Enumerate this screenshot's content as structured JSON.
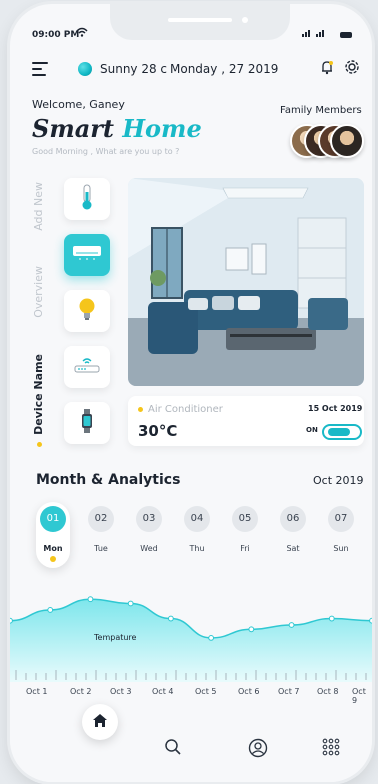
{
  "status_bar": {
    "time": "09:00 PM"
  },
  "header": {
    "weather": "Sunny 28 c",
    "date": "Monday , 27 2019"
  },
  "welcome": {
    "greeting": "Welcome, Ganey",
    "title_a": "Smart",
    "title_b": "Home",
    "subtitle": "Good Morning , What are you up to ?",
    "family_label": "Family Members"
  },
  "side_tabs": [
    {
      "label": "Add New"
    },
    {
      "label": "Overview"
    },
    {
      "label": "Device Name"
    }
  ],
  "devices": [
    {
      "icon": "thermometer-icon"
    },
    {
      "icon": "air-conditioner-icon"
    },
    {
      "icon": "light-bulb-icon"
    },
    {
      "icon": "router-icon"
    },
    {
      "icon": "smartwatch-icon"
    }
  ],
  "ac_card": {
    "name": "Air Conditioner",
    "temp": "30°C",
    "date": "15 Oct 2019",
    "state": "ON"
  },
  "analytics": {
    "title": "Month & Analytics",
    "month": "Oct 2019",
    "days": [
      {
        "num": "01",
        "label": "Mon"
      },
      {
        "num": "02",
        "label": "Tue"
      },
      {
        "num": "03",
        "label": "Wed"
      },
      {
        "num": "04",
        "label": "Thu"
      },
      {
        "num": "05",
        "label": "Fri"
      },
      {
        "num": "06",
        "label": "Sat"
      },
      {
        "num": "07",
        "label": "Sun"
      }
    ]
  },
  "chart_data": {
    "type": "area",
    "title": "",
    "series": [
      {
        "name": "Tempature",
        "values": [
          26,
          28.5,
          31,
          30,
          26.5,
          22,
          24,
          25,
          26.5,
          26
        ]
      }
    ],
    "x": [
      "Oct 1",
      "Oct 2",
      "Oct 3",
      "Oct 4",
      "Oct 5",
      "Oct 6",
      "Oct 7",
      "Oct 8",
      "Oct 9"
    ],
    "ylim": [
      15,
      35
    ],
    "colors": {
      "fill_top": "#7ee6ec",
      "fill_bottom": "#e9fbfc",
      "line": "#2fc8d2"
    }
  },
  "colors": {
    "accent": "#19b9c7",
    "highlight": "#f5c51b"
  }
}
